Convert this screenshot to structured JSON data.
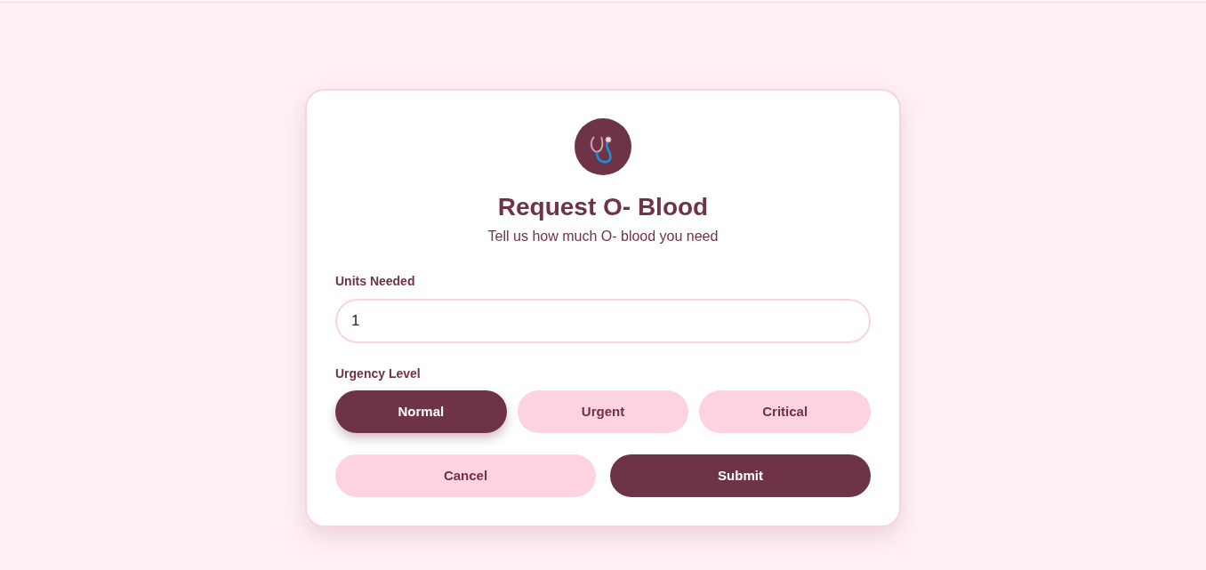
{
  "form": {
    "title": "Request O- Blood",
    "subtitle": "Tell us how much O- blood you need",
    "units": {
      "label": "Units Needed",
      "value": "1"
    },
    "urgency": {
      "label": "Urgency Level",
      "options": [
        {
          "label": "Normal",
          "selected": true
        },
        {
          "label": "Urgent",
          "selected": false
        },
        {
          "label": "Critical",
          "selected": false
        }
      ]
    },
    "buttons": [
      {
        "label": "Cancel",
        "kind": "secondary"
      },
      {
        "label": "Submit",
        "kind": "primary"
      }
    ]
  }
}
